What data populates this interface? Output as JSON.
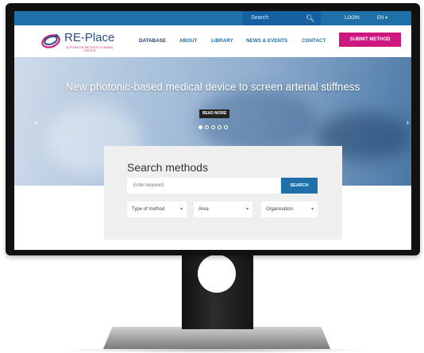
{
  "topbar": {
    "search_label": "Search",
    "search_icon": "search-icon",
    "login": "LOGIN",
    "lang": "EN"
  },
  "header": {
    "logo_text": "RE-Place",
    "logo_subtitle": "ALTERNATIVE METHODS TO ANIMAL TESTING",
    "nav": [
      "DATABASE",
      "ABOUT",
      "LIBRARY",
      "NEWS & EVENTS",
      "CONTACT"
    ],
    "submit": "SUBMIT METHOD"
  },
  "hero": {
    "title": "New photonic-based medical device to screen arterial stiffness",
    "read_more": "READ MORE",
    "slide_count": 5,
    "active_slide": 1
  },
  "search_panel": {
    "title": "Search methods",
    "keyword_placeholder": "Enter keyword",
    "search_button": "SEARCH",
    "filters": [
      "Type of method",
      "Area",
      "Organisation"
    ]
  },
  "colors": {
    "primary": "#1f6fa8",
    "accent": "#cc1880",
    "navy": "#2d4e89"
  }
}
